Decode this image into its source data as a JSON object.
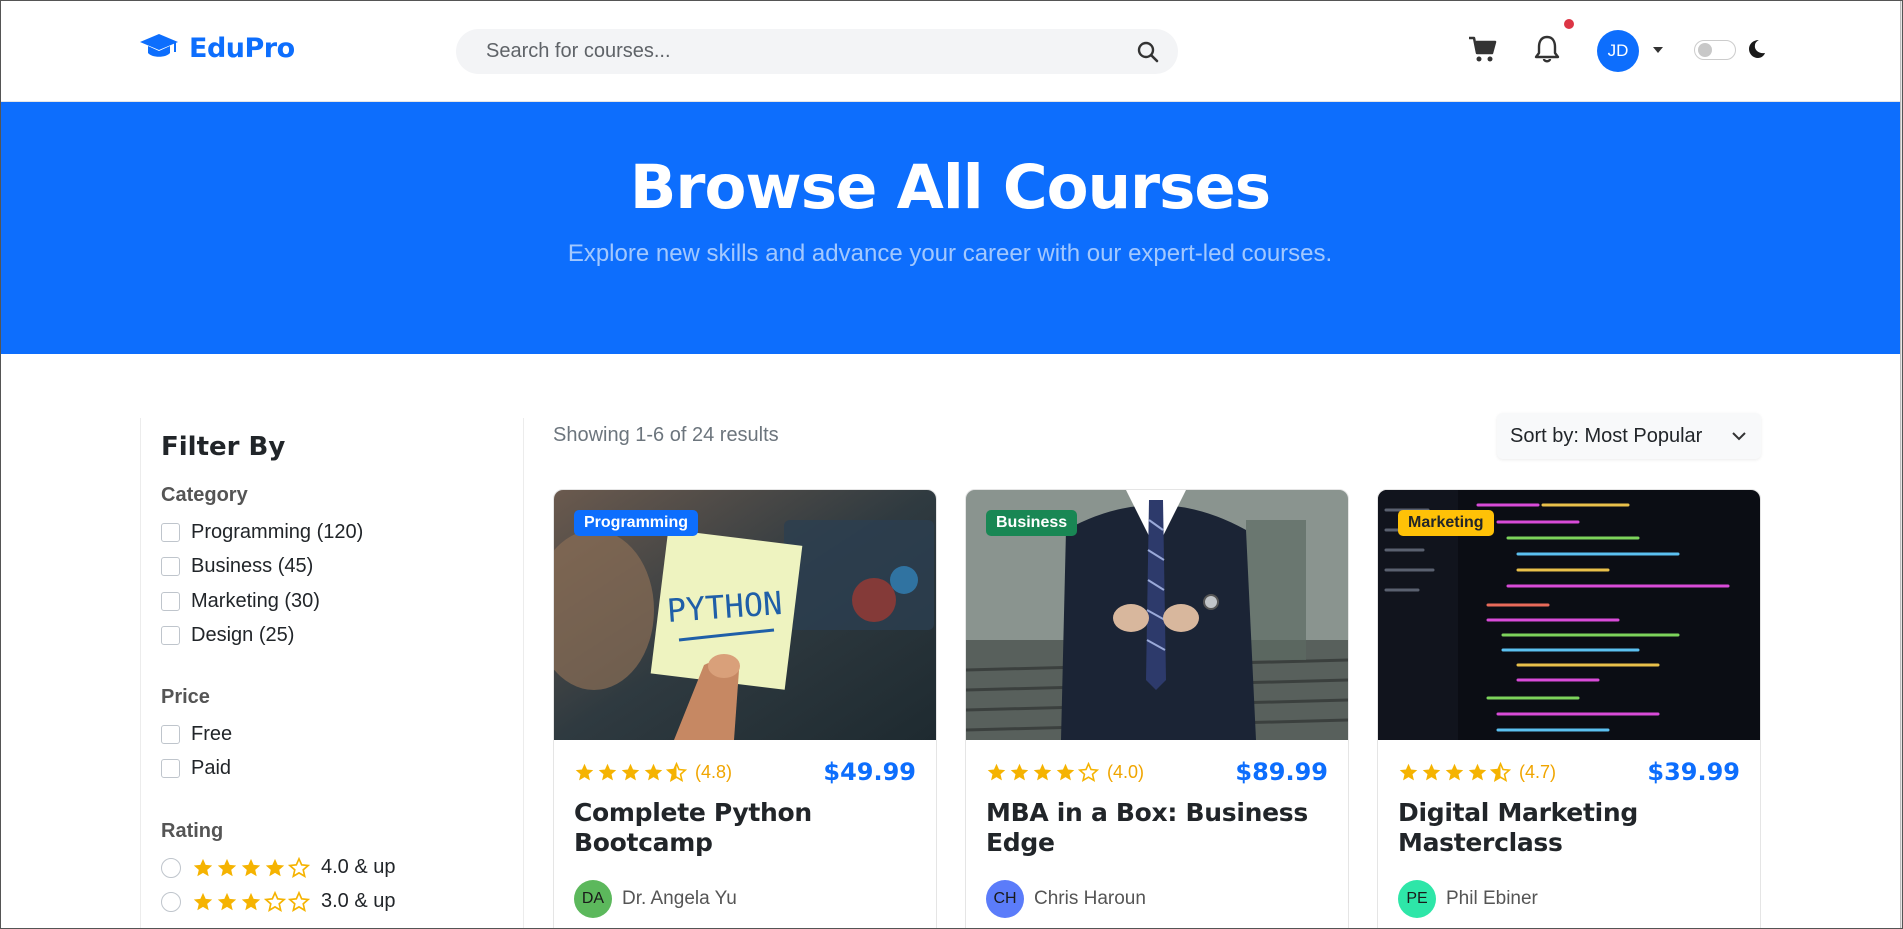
{
  "header": {
    "logo_text": "EduPro",
    "search_placeholder": "Search for courses...",
    "user_initials": "JD"
  },
  "hero": {
    "title": "Browse All Courses",
    "subtitle": "Explore new skills and advance your career with our expert-led courses."
  },
  "sidebar": {
    "title": "Filter By",
    "category": {
      "title": "Category",
      "options": [
        "Programming (120)",
        "Business (45)",
        "Marketing (30)",
        "Design (25)"
      ]
    },
    "price": {
      "title": "Price",
      "options": [
        "Free",
        "Paid"
      ]
    },
    "rating": {
      "title": "Rating",
      "options": [
        {
          "label": "4.0 & up",
          "stars": 4
        },
        {
          "label": "3.0 & up",
          "stars": 3
        }
      ]
    }
  },
  "results": {
    "summary": "Showing 1-6 of 24 results",
    "sort_label": "Sort by: Most Popular"
  },
  "courses": [
    {
      "category": "Programming",
      "badge_color": "#0d6efd",
      "badge_text_color": "#ffffff",
      "thumbnail_text": "PYTHON",
      "rating": 4.5,
      "rating_text": "(4.8)",
      "price": "$49.99",
      "title": "Complete Python Bootcamp",
      "instructor_initials": "DA",
      "instructor_color": "#5cb85c",
      "instructor": "Dr. Angela Yu"
    },
    {
      "category": "Business",
      "badge_color": "#198754",
      "badge_text_color": "#ffffff",
      "rating": 4,
      "rating_text": "(4.0)",
      "price": "$89.99",
      "title": "MBA in a Box: Business Edge",
      "instructor_initials": "CH",
      "instructor_color": "#5b7cfa",
      "instructor": "Chris Haroun"
    },
    {
      "category": "Marketing",
      "badge_color": "#ffc107",
      "badge_text_color": "#212529",
      "rating": 4.5,
      "rating_text": "(4.7)",
      "price": "$39.99",
      "title": "Digital Marketing Masterclass",
      "instructor_initials": "PE",
      "instructor_color": "#2ee6a8",
      "instructor": "Phil Ebiner"
    }
  ],
  "colors": {
    "accent": "#0d6efd",
    "star": "#f5b301"
  }
}
